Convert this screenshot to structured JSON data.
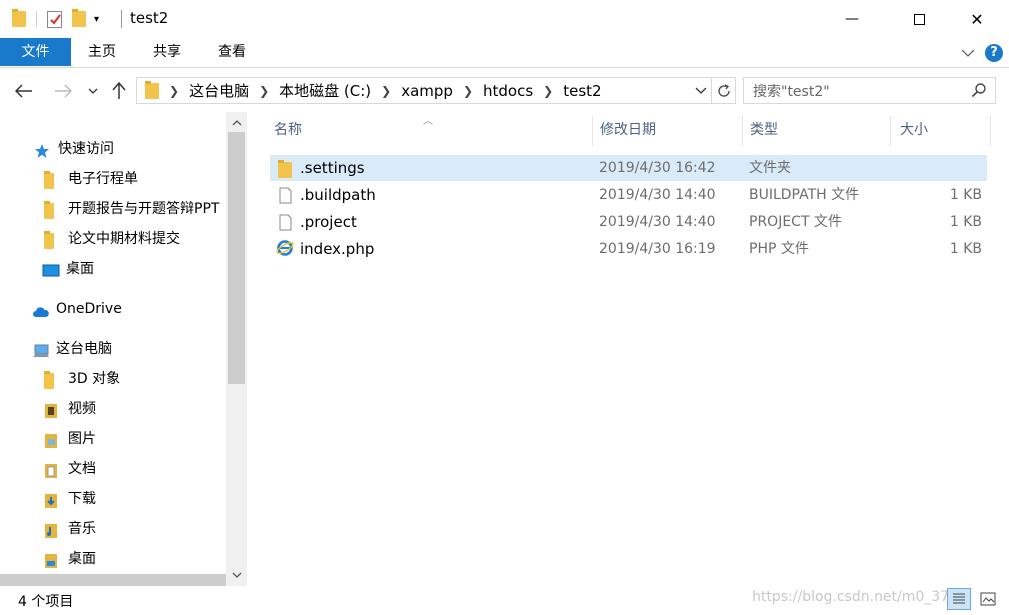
{
  "window": {
    "title": "test2",
    "minimize_glyph": "—",
    "maximize_glyph": "☐",
    "close_glyph": "✕",
    "icons": [
      "folder-icon",
      "properties-icon",
      "new-folder-icon",
      "customize-dropdown-icon"
    ]
  },
  "ribbon": {
    "tabs": [
      "文件",
      "主页",
      "共享",
      "查看"
    ],
    "help_label": "?",
    "accent": "#1979ca"
  },
  "nav": {
    "breadcrumb": [
      "这台电脑",
      "本地磁盘 (C:)",
      "xampp",
      "htdocs",
      "test2"
    ],
    "search_placeholder": "搜索\"test2\""
  },
  "sidebar": {
    "quick_access": "快速访问",
    "quick_items": [
      "电子行程单",
      "开题报告与开题答辩PPT",
      "论文中期材料提交",
      "桌面"
    ],
    "onedrive": "OneDrive",
    "this_pc": "这台电脑",
    "pc_items": [
      "3D 对象",
      "视频",
      "图片",
      "文档",
      "下载",
      "音乐",
      "桌面"
    ]
  },
  "columns": {
    "name": "名称",
    "date": "修改日期",
    "type": "类型",
    "size": "大小"
  },
  "files": [
    {
      "name": ".settings",
      "date": "2019/4/30 16:42",
      "type": "文件夹",
      "size": "",
      "icon": "folder-icon",
      "selected": true
    },
    {
      "name": ".buildpath",
      "date": "2019/4/30 14:40",
      "type": "BUILDPATH 文件",
      "size": "1 KB",
      "icon": "file-icon",
      "selected": false
    },
    {
      "name": ".project",
      "date": "2019/4/30 14:40",
      "type": "PROJECT 文件",
      "size": "1 KB",
      "icon": "file-icon",
      "selected": false
    },
    {
      "name": "index.php",
      "date": "2019/4/30 16:19",
      "type": "PHP 文件",
      "size": "1 KB",
      "icon": "ie-icon",
      "selected": false
    }
  ],
  "status": {
    "count": "4 个项目",
    "watermark": "https://blog.csdn.net/m0_37..."
  }
}
